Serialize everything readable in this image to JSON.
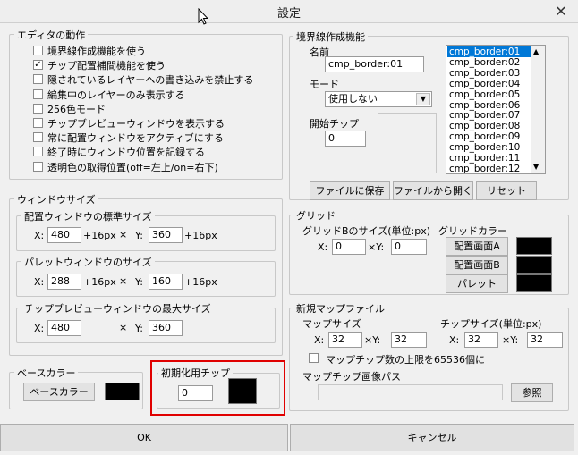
{
  "title": "設定",
  "editor": {
    "legend": "エディタの動作",
    "options": [
      {
        "label": "境界線作成機能を使う",
        "checked": false
      },
      {
        "label": "チップ配置補間機能を使う",
        "checked": true
      },
      {
        "label": "隠されているレイヤーへの書き込みを禁止する",
        "checked": false
      },
      {
        "label": "編集中のレイヤーのみ表示する",
        "checked": false
      },
      {
        "label": "256色モード",
        "checked": false
      },
      {
        "label": "チップブレビューウィンドウを表示する",
        "checked": false
      },
      {
        "label": "常に配置ウィンドウをアクティブにする",
        "checked": false
      },
      {
        "label": "終了時にウィンドウ位置を記録する",
        "checked": false
      },
      {
        "label": "透明色の取得位置(off=左上/on=右下)",
        "checked": false
      }
    ]
  },
  "window_size": {
    "legend": "ウィンドウサイズ",
    "placement": {
      "legend": "配置ウィンドウの標準サイズ",
      "x": "480",
      "y": "360",
      "x_suffix": "+16px",
      "y_suffix": "+16px"
    },
    "palette": {
      "legend": "パレットウィンドウのサイズ",
      "x": "288",
      "y": "160",
      "x_suffix": "+16px",
      "y_suffix": "+16px"
    },
    "preview": {
      "legend": "チップブレビューウィンドウの最大サイズ",
      "x": "480",
      "y": "360"
    },
    "x_label": "X:",
    "y_label": "Y:",
    "times": "×"
  },
  "base_color": {
    "legend": "ベースカラー",
    "button": "ベースカラー",
    "color": "#000000"
  },
  "init_chip": {
    "legend": "初期化用チップ",
    "value": "0",
    "color": "#000000"
  },
  "border": {
    "legend": "境界線作成機能",
    "name_label": "名前",
    "name_value": "cmp_border:01",
    "mode_label": "モード",
    "mode_value": "使用しない",
    "start_chip_label": "開始チップ",
    "start_chip_value": "0",
    "list": [
      "cmp_border:01",
      "cmp_border:02",
      "cmp_border:03",
      "cmp_border:04",
      "cmp_border:05",
      "cmp_border:06",
      "cmp_border:07",
      "cmp_border:08",
      "cmp_border:09",
      "cmp_border:10",
      "cmp_border:11",
      "cmp_border:12"
    ],
    "selected_index": 0,
    "save_button": "ファイルに保存",
    "open_button": "ファイルから開く",
    "reset_button": "リセット"
  },
  "grid": {
    "legend": "グリッド",
    "size_label": "グリッドBのサイズ(単位:px)",
    "x_label": "X:",
    "y_label": "×Y:",
    "x": "0",
    "y": "0",
    "color_label": "グリッドカラー",
    "buttons": [
      "配置画面A",
      "配置画面B",
      "パレット"
    ],
    "colors": [
      "#000000",
      "#000000",
      "#000000"
    ]
  },
  "new_map": {
    "legend": "新規マップファイル",
    "map_size_label": "マップサイズ",
    "chip_size_label": "チップサイズ(単位:px)",
    "x_label": "X:",
    "y_label": "×Y:",
    "map_x": "32",
    "map_y": "32",
    "chip_x": "32",
    "chip_y": "32",
    "limit_label": "マップチップ数の上限を65536個に",
    "limit_checked": false,
    "image_path_label": "マップチップ画像パス",
    "image_path_value": "",
    "browse_button": "参照"
  },
  "footer": {
    "ok": "OK",
    "cancel": "キャンセル"
  }
}
